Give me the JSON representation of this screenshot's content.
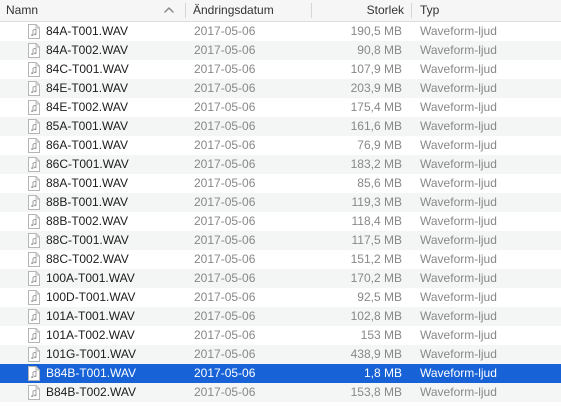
{
  "columns": {
    "name": "Namn",
    "modified": "Ändringsdatum",
    "size": "Storlek",
    "kind": "Typ"
  },
  "sort_icon": "chevron-up-icon",
  "file_icon": "audio-file-icon",
  "colors": {
    "selection": "#1762d6",
    "stripe": "#f4f5f5",
    "secondary_text": "#888888"
  },
  "files": [
    {
      "name": "84A-T001.WAV",
      "modified": "2017-05-06",
      "size": "190,5 MB",
      "kind": "Waveform-ljud"
    },
    {
      "name": "84A-T002.WAV",
      "modified": "2017-05-06",
      "size": "90,8 MB",
      "kind": "Waveform-ljud"
    },
    {
      "name": "84C-T001.WAV",
      "modified": "2017-05-06",
      "size": "107,9 MB",
      "kind": "Waveform-ljud"
    },
    {
      "name": "84E-T001.WAV",
      "modified": "2017-05-06",
      "size": "203,9 MB",
      "kind": "Waveform-ljud"
    },
    {
      "name": "84E-T002.WAV",
      "modified": "2017-05-06",
      "size": "175,4 MB",
      "kind": "Waveform-ljud"
    },
    {
      "name": "85A-T001.WAV",
      "modified": "2017-05-06",
      "size": "161,6 MB",
      "kind": "Waveform-ljud"
    },
    {
      "name": "86A-T001.WAV",
      "modified": "2017-05-06",
      "size": "76,9 MB",
      "kind": "Waveform-ljud"
    },
    {
      "name": "86C-T001.WAV",
      "modified": "2017-05-06",
      "size": "183,2 MB",
      "kind": "Waveform-ljud"
    },
    {
      "name": "88A-T001.WAV",
      "modified": "2017-05-06",
      "size": "85,6 MB",
      "kind": "Waveform-ljud"
    },
    {
      "name": "88B-T001.WAV",
      "modified": "2017-05-06",
      "size": "119,3 MB",
      "kind": "Waveform-ljud"
    },
    {
      "name": "88B-T002.WAV",
      "modified": "2017-05-06",
      "size": "118,4 MB",
      "kind": "Waveform-ljud"
    },
    {
      "name": "88C-T001.WAV",
      "modified": "2017-05-06",
      "size": "117,5 MB",
      "kind": "Waveform-ljud"
    },
    {
      "name": "88C-T002.WAV",
      "modified": "2017-05-06",
      "size": "151,2 MB",
      "kind": "Waveform-ljud"
    },
    {
      "name": "100A-T001.WAV",
      "modified": "2017-05-06",
      "size": "170,2 MB",
      "kind": "Waveform-ljud"
    },
    {
      "name": "100D-T001.WAV",
      "modified": "2017-05-06",
      "size": "92,5 MB",
      "kind": "Waveform-ljud"
    },
    {
      "name": "101A-T001.WAV",
      "modified": "2017-05-06",
      "size": "102,8 MB",
      "kind": "Waveform-ljud"
    },
    {
      "name": "101A-T002.WAV",
      "modified": "2017-05-06",
      "size": "153 MB",
      "kind": "Waveform-ljud"
    },
    {
      "name": "101G-T001.WAV",
      "modified": "2017-05-06",
      "size": "438,9 MB",
      "kind": "Waveform-ljud"
    },
    {
      "name": "B84B-T001.WAV",
      "modified": "2017-05-06",
      "size": "1,8 MB",
      "kind": "Waveform-ljud",
      "selected": true
    },
    {
      "name": "B84B-T002.WAV",
      "modified": "2017-05-06",
      "size": "153,8 MB",
      "kind": "Waveform-ljud"
    }
  ]
}
